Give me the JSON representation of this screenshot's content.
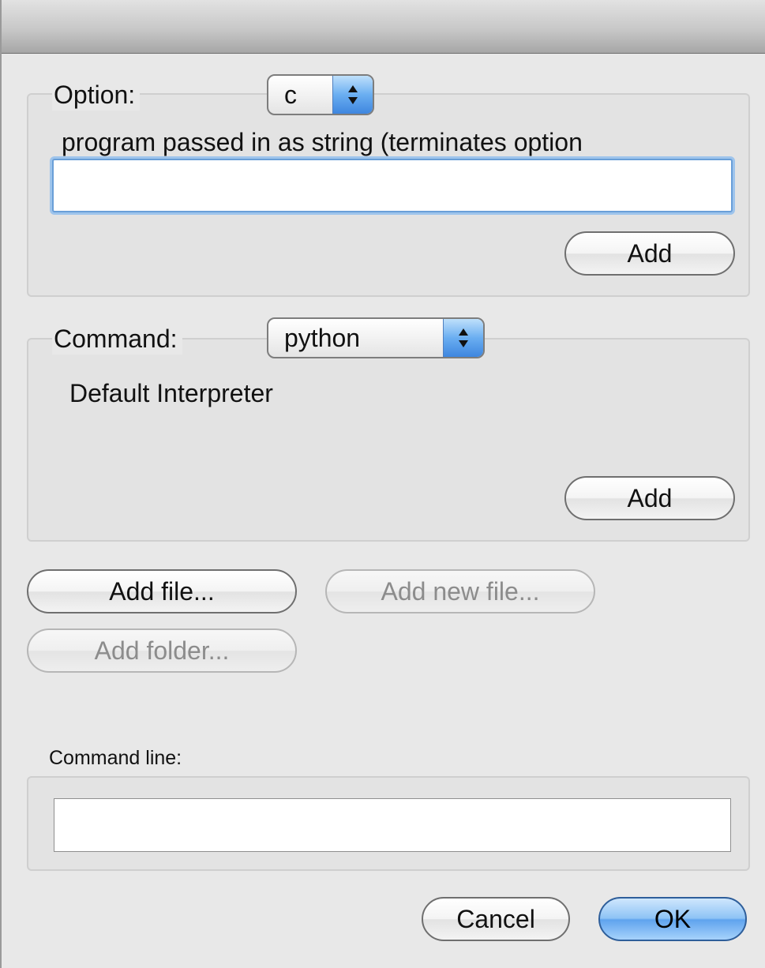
{
  "option_group": {
    "label": "Option:",
    "popup_value": "c",
    "description": "program passed in as string (terminates option",
    "input_value": "",
    "add_label": "Add"
  },
  "command_group": {
    "label": "Command:",
    "popup_value": "python",
    "description": "Default Interpreter",
    "add_label": "Add"
  },
  "file_buttons": {
    "add_file": "Add file...",
    "add_new_file": "Add new file...",
    "add_folder": "Add folder..."
  },
  "command_line": {
    "label": "Command line:",
    "value": ""
  },
  "footer": {
    "cancel": "Cancel",
    "ok": "OK"
  },
  "colors": {
    "accent": "#5fa3ee",
    "window_bg": "#e8e8e8"
  },
  "icons": {
    "popup_stepper": "up-down-arrows-icon"
  }
}
